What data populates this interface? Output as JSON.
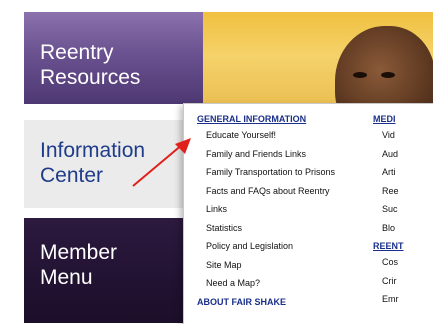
{
  "sidebar": {
    "resources": [
      "Reentry",
      "Resources"
    ],
    "info": [
      "Information",
      "Center"
    ],
    "member": [
      "Member",
      "Menu"
    ]
  },
  "dropdown": {
    "left_heading": "GENERAL INFORMATION",
    "left_links": [
      "Educate Yourself!",
      "Family and Friends Links",
      "Family Transportation to Prisons",
      "Facts and FAQs about Reentry",
      "Links",
      "Statistics",
      "Policy and Legislation",
      "Site Map",
      "Need a Map?"
    ],
    "left_footer_heading": "ABOUT FAIR SHAKE",
    "right_heading": "MEDI",
    "right_links_a": [
      "Vid",
      "Aud",
      "Arti",
      "Ree",
      "Suc",
      "Blo"
    ],
    "right_heading2": "REENT",
    "right_links_b": [
      "Cos",
      "Crir",
      "Emr"
    ]
  },
  "colors": {
    "accent_purple": "#6a5290",
    "dark_purple": "#221232",
    "link_blue": "#1a2f8a",
    "arrow_red": "#e0201a"
  }
}
